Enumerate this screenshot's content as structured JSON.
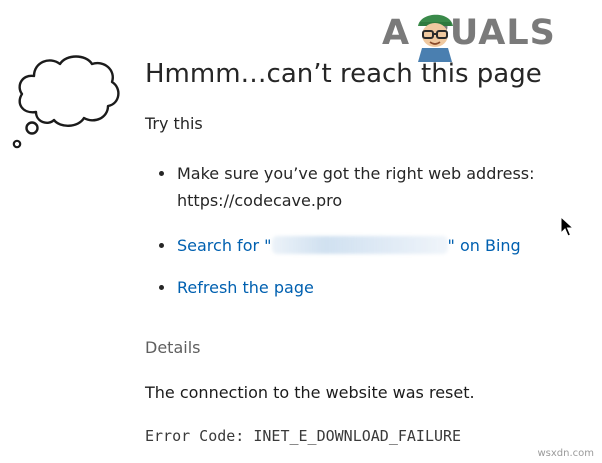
{
  "error_page": {
    "title": "Hmmm…can’t reach this page",
    "try_this": "Try this",
    "suggestions": [
      {
        "text_line1": "Make sure you’ve got the right web address:",
        "text_line2": "https://codecave.pro"
      },
      {
        "search_prefix": "Search for \"",
        "search_suffix": "\" on Bing"
      },
      {
        "label": "Refresh the page"
      }
    ],
    "details_heading": "Details",
    "details_text": "The connection to the website was reset.",
    "error_code": "Error Code: INET_E_DOWNLOAD_FAILURE"
  },
  "overlays": {
    "brand_watermark_text": "A PUALS",
    "source_watermark": "wsxdn.com"
  },
  "icons": {
    "thought_cloud": "thought-cloud-icon",
    "mouse_cursor": "mouse-cursor-icon",
    "mascot": "appuals-mascot-icon"
  },
  "colors": {
    "link": "#0060b0",
    "text": "#262626",
    "muted": "#5f5f5f"
  }
}
